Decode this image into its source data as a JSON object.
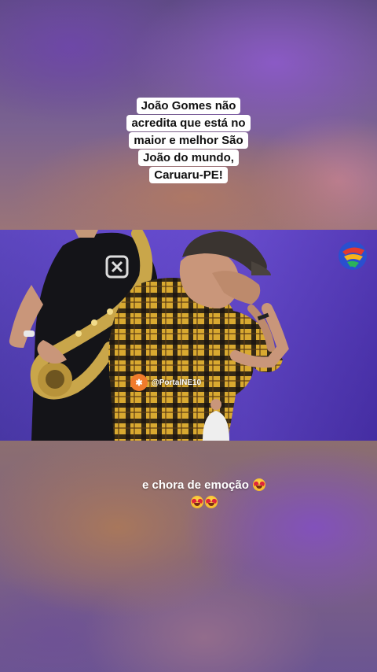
{
  "caption_top": {
    "lines": [
      "João Gomes não",
      "acredita que está no",
      "maior e melhor São",
      "João do mundo,",
      "Caruaru-PE!"
    ]
  },
  "video": {
    "watermark_text": "@PortalNE10",
    "shirt_logo": "X"
  },
  "caption_bottom": {
    "text": "e chora de emoção",
    "emoji": "heart-eyes-face"
  },
  "colors": {
    "stage_purple": "#5a40c4",
    "plaid_yellow": "#d9a930",
    "watermark_orange": "#f07b2c"
  }
}
